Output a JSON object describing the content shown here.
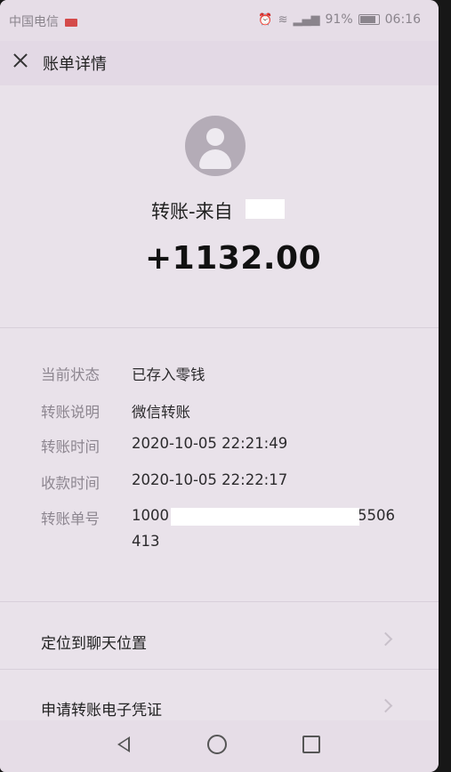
{
  "status_bar": {
    "carrier": "中国电信",
    "battery": "91%",
    "time": "06:16"
  },
  "header": {
    "title": "账单详情"
  },
  "transfer": {
    "title": "转账-来自",
    "amount": "+1132.00"
  },
  "details": [
    {
      "label": "当前状态",
      "value": "已存入零钱"
    },
    {
      "label": "转账说明",
      "value": "微信转账"
    },
    {
      "label": "转账时间",
      "value": "2020-10-05 22:21:49"
    },
    {
      "label": "收款时间",
      "value": "2020-10-05 22:22:17"
    },
    {
      "label": "转账单号",
      "value": "1000",
      "value_suffix": "5506",
      "value_line2": "413"
    }
  ],
  "actions": [
    {
      "label": "定位到聊天位置"
    },
    {
      "label": "申请转账电子凭证"
    }
  ],
  "colors": {
    "background": "#e9e2ea",
    "header": "#e3d9e5"
  }
}
